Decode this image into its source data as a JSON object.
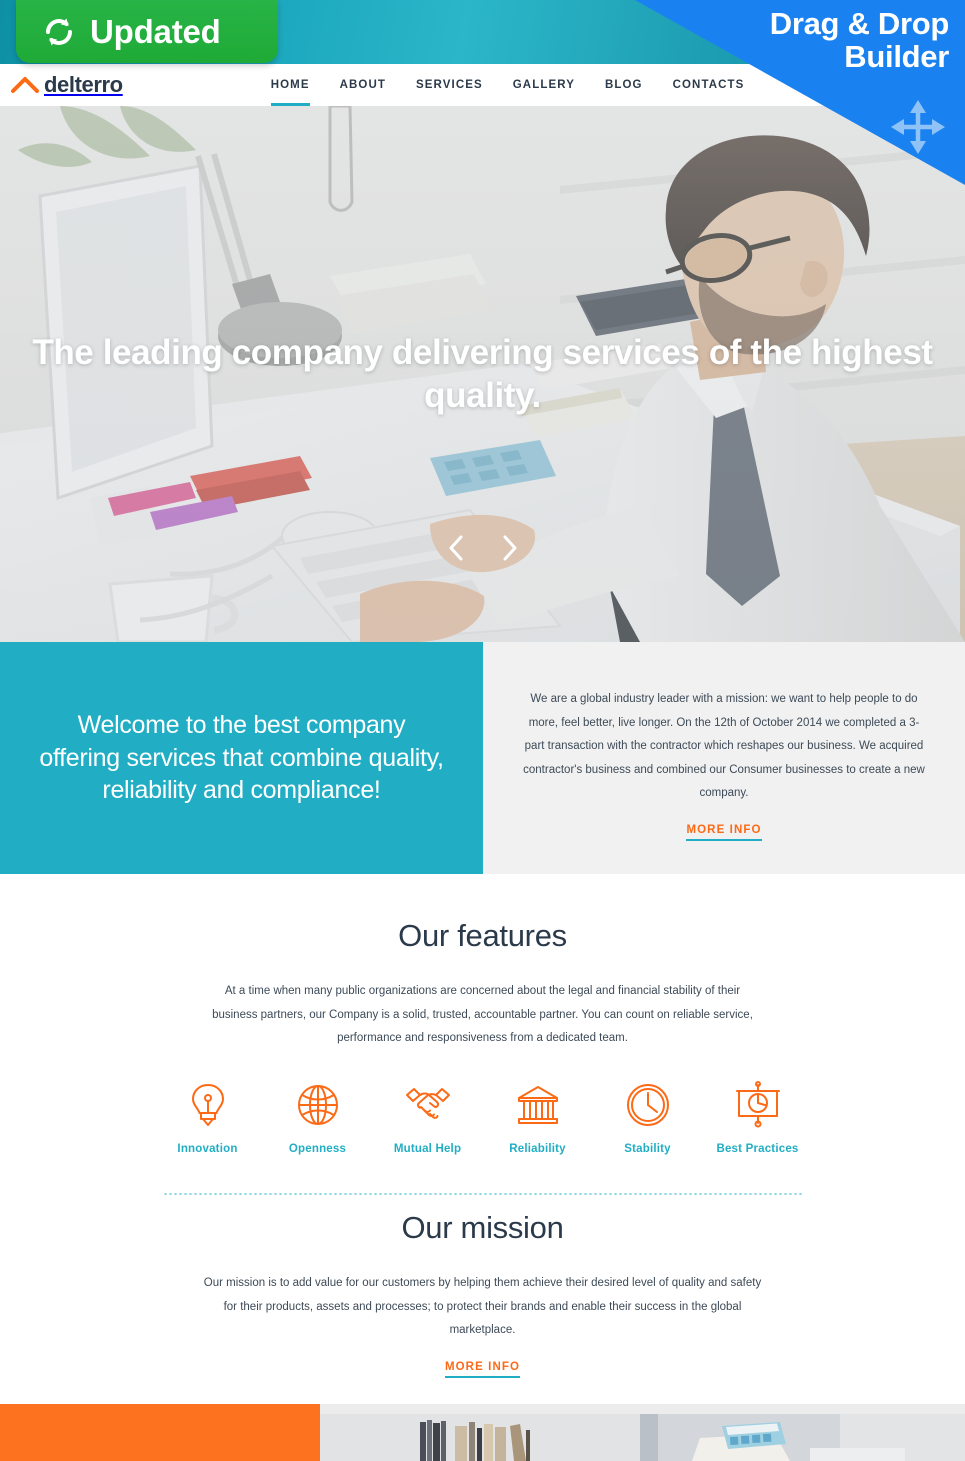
{
  "promo": {
    "updated_badge": "Updated",
    "updated_icon": "sync-refresh-icon",
    "ribbon_line1": "Drag & Drop",
    "ribbon_line2": "Builder",
    "ribbon_icon": "move-arrows-icon",
    "band_color": "#21aec4",
    "badge_color": "#22ac3e",
    "ribbon_color": "#1a82f0"
  },
  "header": {
    "logo_text": "delterro",
    "logo_icon": "chevron-up-logo-icon",
    "logo_color": "#fc6a16",
    "nav": [
      {
        "label": "HOME",
        "active": true
      },
      {
        "label": "ABOUT",
        "active": false
      },
      {
        "label": "SERVICES",
        "active": false
      },
      {
        "label": "GALLERY",
        "active": false
      },
      {
        "label": "BLOG",
        "active": false
      },
      {
        "label": "CONTACTS",
        "active": false
      }
    ]
  },
  "hero": {
    "title": "The leading company delivering services of the highest quality.",
    "prev_icon": "chevron-left-icon",
    "next_icon": "chevron-right-icon",
    "image_alt": "Businessman in white shirt and tie typing on a keyboard at a white desk with monitor, lamp, notebook and calculator"
  },
  "welcome": {
    "heading": "Welcome to the best company offering services that combine quality, reliability and compliance!",
    "body": "We are a global industry leader with a mission: we want to help people to do more, feel better, live longer. On the 12th of October 2014 we completed a 3-part transaction with the contractor which reshapes our business. We acquired contractor's business and combined our Consumer businesses to create a new company.",
    "more_info": "MORE INFO",
    "panel_color": "#21aec4",
    "link_color": "#fc6a16"
  },
  "features": {
    "title": "Our features",
    "body": "At a time when many public organizations are concerned about the legal and financial stability of their business partners, our Company is a solid, trusted, accountable partner. You can count on reliable service, performance and responsiveness from a dedicated team.",
    "items": [
      {
        "label": "Innovation",
        "icon": "lightbulb-icon"
      },
      {
        "label": "Openness",
        "icon": "globe-icon"
      },
      {
        "label": "Mutual Help",
        "icon": "handshake-icon"
      },
      {
        "label": "Reliability",
        "icon": "bank-columns-icon"
      },
      {
        "label": "Stability",
        "icon": "clock-icon"
      },
      {
        "label": "Best Practices",
        "icon": "presentation-chart-icon"
      }
    ],
    "icon_color": "#fc6a16",
    "label_color": "#21aec4"
  },
  "mission": {
    "title": "Our mission",
    "body": "Our mission is to add value for our customers by helping them achieve their desired level of quality and safety for their products, assets and processes; to protect their brands and enable their success in the global marketplace.",
    "more_info": "MORE INFO"
  },
  "bottom": {
    "block_color": "#fc721e",
    "photo_a_alt": "Row of books and binders on a white shelf",
    "photo_b_alt": "Blue calculator on a white desk"
  }
}
